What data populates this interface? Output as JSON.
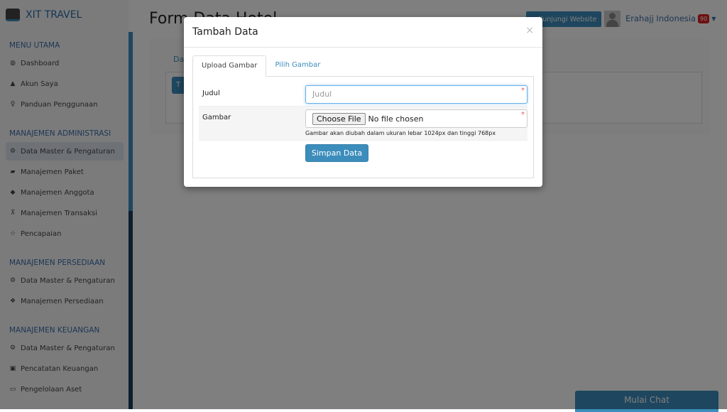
{
  "sidebar": {
    "brand": "XIT TRAVEL",
    "sections": [
      {
        "title": "MENU UTAMA",
        "items": [
          {
            "icon": "globe-icon",
            "label": "Dashboard"
          },
          {
            "icon": "user-icon",
            "label": "Akun Saya"
          },
          {
            "icon": "lightbulb-icon",
            "label": "Panduan Penggunaan"
          }
        ]
      },
      {
        "title": "MANAJEMEN ADMINISTRASI",
        "items": [
          {
            "icon": "cogs-icon",
            "label": "Data Master & Pengaturan",
            "active": true
          },
          {
            "icon": "book-icon",
            "label": "Manajemen Paket"
          },
          {
            "icon": "users-icon",
            "label": "Manajemen Anggota"
          },
          {
            "icon": "cart-icon",
            "label": "Manajemen Transaksi"
          },
          {
            "icon": "star-icon",
            "label": "Pencapaian"
          }
        ]
      },
      {
        "title": "MANAJEMEN PERSEDIAAN",
        "items": [
          {
            "icon": "cogs-icon",
            "label": "Data Master & Pengaturan"
          },
          {
            "icon": "cubes-icon",
            "label": "Manajemen Persediaan"
          }
        ]
      },
      {
        "title": "MANAJEMEN KEUANGAN",
        "items": [
          {
            "icon": "cogs-icon",
            "label": "Data Master & Pengaturan"
          },
          {
            "icon": "money-icon",
            "label": "Pencatatan Keuangan"
          },
          {
            "icon": "laptop-icon",
            "label": "Pengelolaan Aset"
          }
        ]
      }
    ]
  },
  "header": {
    "page_title": "Form Data Hotel",
    "visit_label": "Kunjungi Website",
    "user_name": "Erahajj Indonesia",
    "badge": "90"
  },
  "content": {
    "tab_label": "Da",
    "add_label": "T"
  },
  "chat_label": "Mulai Chat",
  "modal": {
    "title": "Tambah Data",
    "close": "×",
    "tabs": [
      {
        "label": "Upload Gambar",
        "active": true
      },
      {
        "label": "Pilih Gambar"
      }
    ],
    "judul_label": "Judul",
    "judul_placeholder": "Judul",
    "gambar_label": "Gambar",
    "choose_file": "Choose File",
    "no_file": "No file chosen",
    "help": "Gambar akan diubah dalam ukuran lebar 1024px dan tinggi 768px",
    "required": "*",
    "save_label": "Simpan Data"
  },
  "colors": {
    "primary": "#3c8dbc",
    "badge": "#dd2222"
  }
}
